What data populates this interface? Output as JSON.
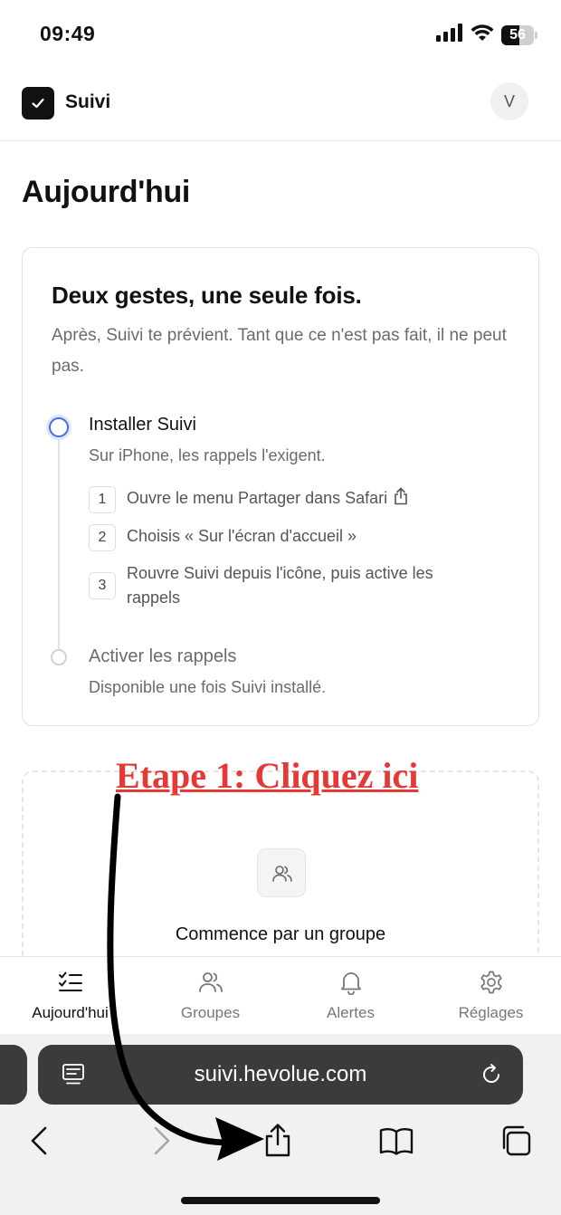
{
  "status_bar": {
    "time": "09:49",
    "battery": "56",
    "battery_level": 0.56,
    "icons": [
      "signal-icon",
      "wifi-icon",
      "battery-icon"
    ]
  },
  "header": {
    "app_name": "Suivi",
    "avatar_initial": "V"
  },
  "page_title": "Aujourd'hui",
  "onboarding": {
    "title": "Deux gestes, une seule fois.",
    "subtitle": "Après, Suivi te prévient. Tant que ce n'est pas fait, il ne peut pas.",
    "steps": [
      {
        "title": "Installer Suivi",
        "description": "Sur iPhone, les rappels l'exigent.",
        "substeps": [
          {
            "number": "1",
            "text": "Ouvre le menu Partager dans Safari"
          },
          {
            "number": "2",
            "text": "Choisis « Sur l'écran d'accueil »"
          },
          {
            "number": "3",
            "text": "Rouvre Suivi depuis l'icône, puis active les rappels"
          }
        ]
      },
      {
        "title": "Activer les rappels",
        "description": "Disponible une fois Suivi installé."
      }
    ]
  },
  "groups_empty": {
    "title": "Commence par un groupe"
  },
  "tabs": [
    {
      "label": "Aujourd'hui",
      "icon": "checklist-icon",
      "active": true
    },
    {
      "label": "Groupes",
      "icon": "users-icon",
      "active": false
    },
    {
      "label": "Alertes",
      "icon": "bell-icon",
      "active": false
    },
    {
      "label": "Réglages",
      "icon": "gear-icon",
      "active": false
    }
  ],
  "browser": {
    "url": "suivi.hevolue.com"
  },
  "annotation": {
    "text": "Etape 1: Cliquez ici"
  },
  "colors": {
    "accent": "#4a6fd6",
    "annotation": "#e53935",
    "browser_bar": "#3b3b3b"
  }
}
